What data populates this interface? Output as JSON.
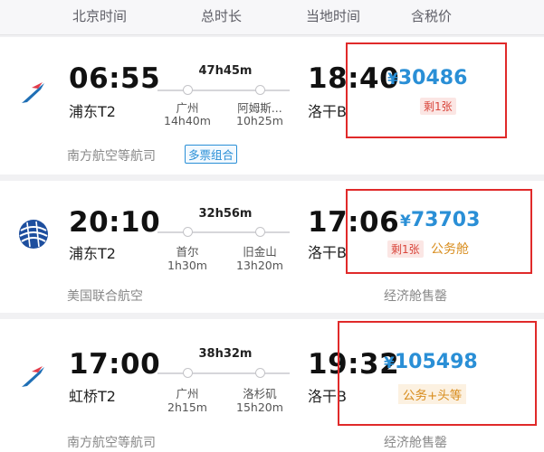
{
  "header": {
    "col_beijing_time": "北京时间",
    "col_total_duration": "总时长",
    "col_local_time": "当地时间",
    "col_price_tax": "含税价"
  },
  "flights": [
    {
      "airline_logo_icon": "china-southern-logo",
      "dep_time": "06:55",
      "dep_terminal": "浦东T2",
      "duration": "47h45m",
      "stops": [
        {
          "city": "广州",
          "layover": "14h40m"
        },
        {
          "city": "阿姆斯...",
          "layover": "10h25m"
        }
      ],
      "arr_time": "18:40",
      "arr_terminal": "洛干B",
      "price_symbol": "¥",
      "price": "30486",
      "tickets_left": "剩1张",
      "airline": "南方航空等航司",
      "combo_badge": "多票组合"
    },
    {
      "airline_logo_icon": "united-airlines-logo",
      "dep_time": "20:10",
      "dep_terminal": "浦东T2",
      "duration": "32h56m",
      "stops": [
        {
          "city": "首尔",
          "layover": "1h30m"
        },
        {
          "city": "旧金山",
          "layover": "13h20m"
        }
      ],
      "arr_time": "17:06",
      "arr_terminal": "洛干B",
      "price_symbol": "¥",
      "price": "73703",
      "tickets_left": "剩1张",
      "cabin": "公务舱",
      "airline": "美国联合航空",
      "sold_out_note": "经济舱售罄"
    },
    {
      "airline_logo_icon": "china-southern-logo",
      "dep_time": "17:00",
      "dep_terminal": "虹桥T2",
      "duration": "38h32m",
      "stops": [
        {
          "city": "广州",
          "layover": "2h15m"
        },
        {
          "city": "洛杉矶",
          "layover": "15h20m"
        }
      ],
      "arr_time": "19:32",
      "arr_terminal": "洛干B",
      "price_symbol": "¥",
      "price": "105498",
      "cabin": "公务+头等",
      "airline": "南方航空等航司",
      "sold_out_note": "经济舱售罄"
    }
  ],
  "colors": {
    "price_blue": "#2a8fd6",
    "annotation_red": "#e02a2a",
    "cabin_orange": "#d88d1e",
    "tickets_left_red": "#d9453b"
  }
}
